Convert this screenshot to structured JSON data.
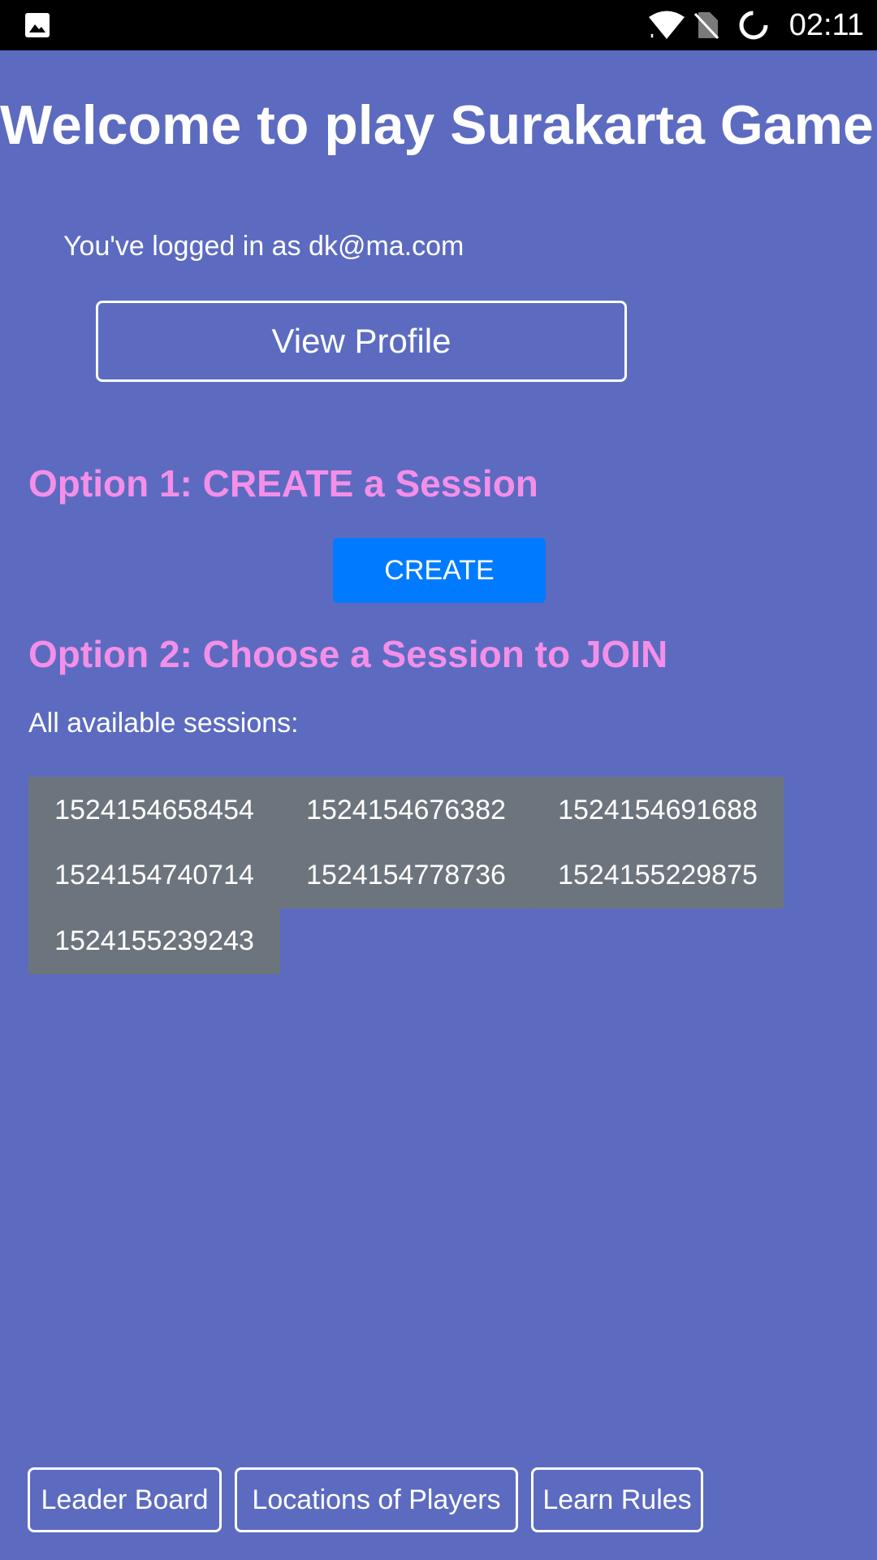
{
  "status_bar": {
    "time": "02:11",
    "icons": [
      "gallery-icon",
      "wifi-icon",
      "no-sim-icon",
      "battery-charging-icon"
    ]
  },
  "headline": "Welcome to play Surakarta Game!",
  "login_text": "You've logged in as dk@ma.com",
  "view_profile_label": "View Profile",
  "option1": {
    "heading": "Option 1: CREATE a Session",
    "button_label": "CREATE"
  },
  "option2": {
    "heading": "Option 2: Choose a Session to JOIN",
    "sessions_label": "All available sessions:",
    "sessions": [
      "1524154658454",
      "1524154676382",
      "1524154691688",
      "1524154740714",
      "1524154778736",
      "1524155229875",
      "1524155239243"
    ]
  },
  "bottom_nav": {
    "leaderboard": "Leader Board",
    "locations": "Locations of Players",
    "rules": "Learn Rules"
  },
  "colors": {
    "background": "#5c6bc0",
    "heading_accent": "#f48fe8",
    "create_button": "#007bff",
    "session_button": "#6c757d",
    "status_bar": "#000000"
  }
}
